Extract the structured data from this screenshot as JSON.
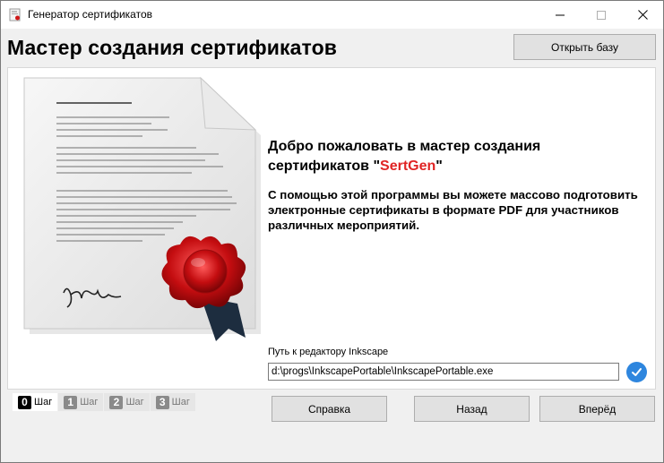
{
  "window": {
    "title": "Генератор сертификатов",
    "controls": {
      "minimize": "minimize-icon",
      "maximize": "maximize-icon",
      "close": "close-icon"
    }
  },
  "header": {
    "title": "Мастер создания сертификатов",
    "open_db_label": "Открыть базу"
  },
  "welcome": {
    "title_line1": "Добро пожаловать в мастер создания",
    "title_line2_prefix": "сертификатов \"",
    "brand": "SertGen",
    "title_line2_suffix": "\"",
    "description": "С помощью этой программы вы можете массово подготовить электронные сертификаты в формате PDF для участников различных мероприятий."
  },
  "inkscape": {
    "label": "Путь к редактору Inkscape",
    "value": "d:\\progs\\InkscapePortable\\InkscapePortable.exe"
  },
  "steps": [
    {
      "num": "0",
      "label": "Шаг",
      "active": true
    },
    {
      "num": "1",
      "label": "Шаг",
      "active": false
    },
    {
      "num": "2",
      "label": "Шаг",
      "active": false
    },
    {
      "num": "3",
      "label": "Шаг",
      "active": false
    }
  ],
  "buttons": {
    "help": "Справка",
    "back": "Назад",
    "next": "Вперёд"
  },
  "colors": {
    "brand": "#e02424",
    "check": "#2e86de",
    "seal": "#c40d10"
  }
}
